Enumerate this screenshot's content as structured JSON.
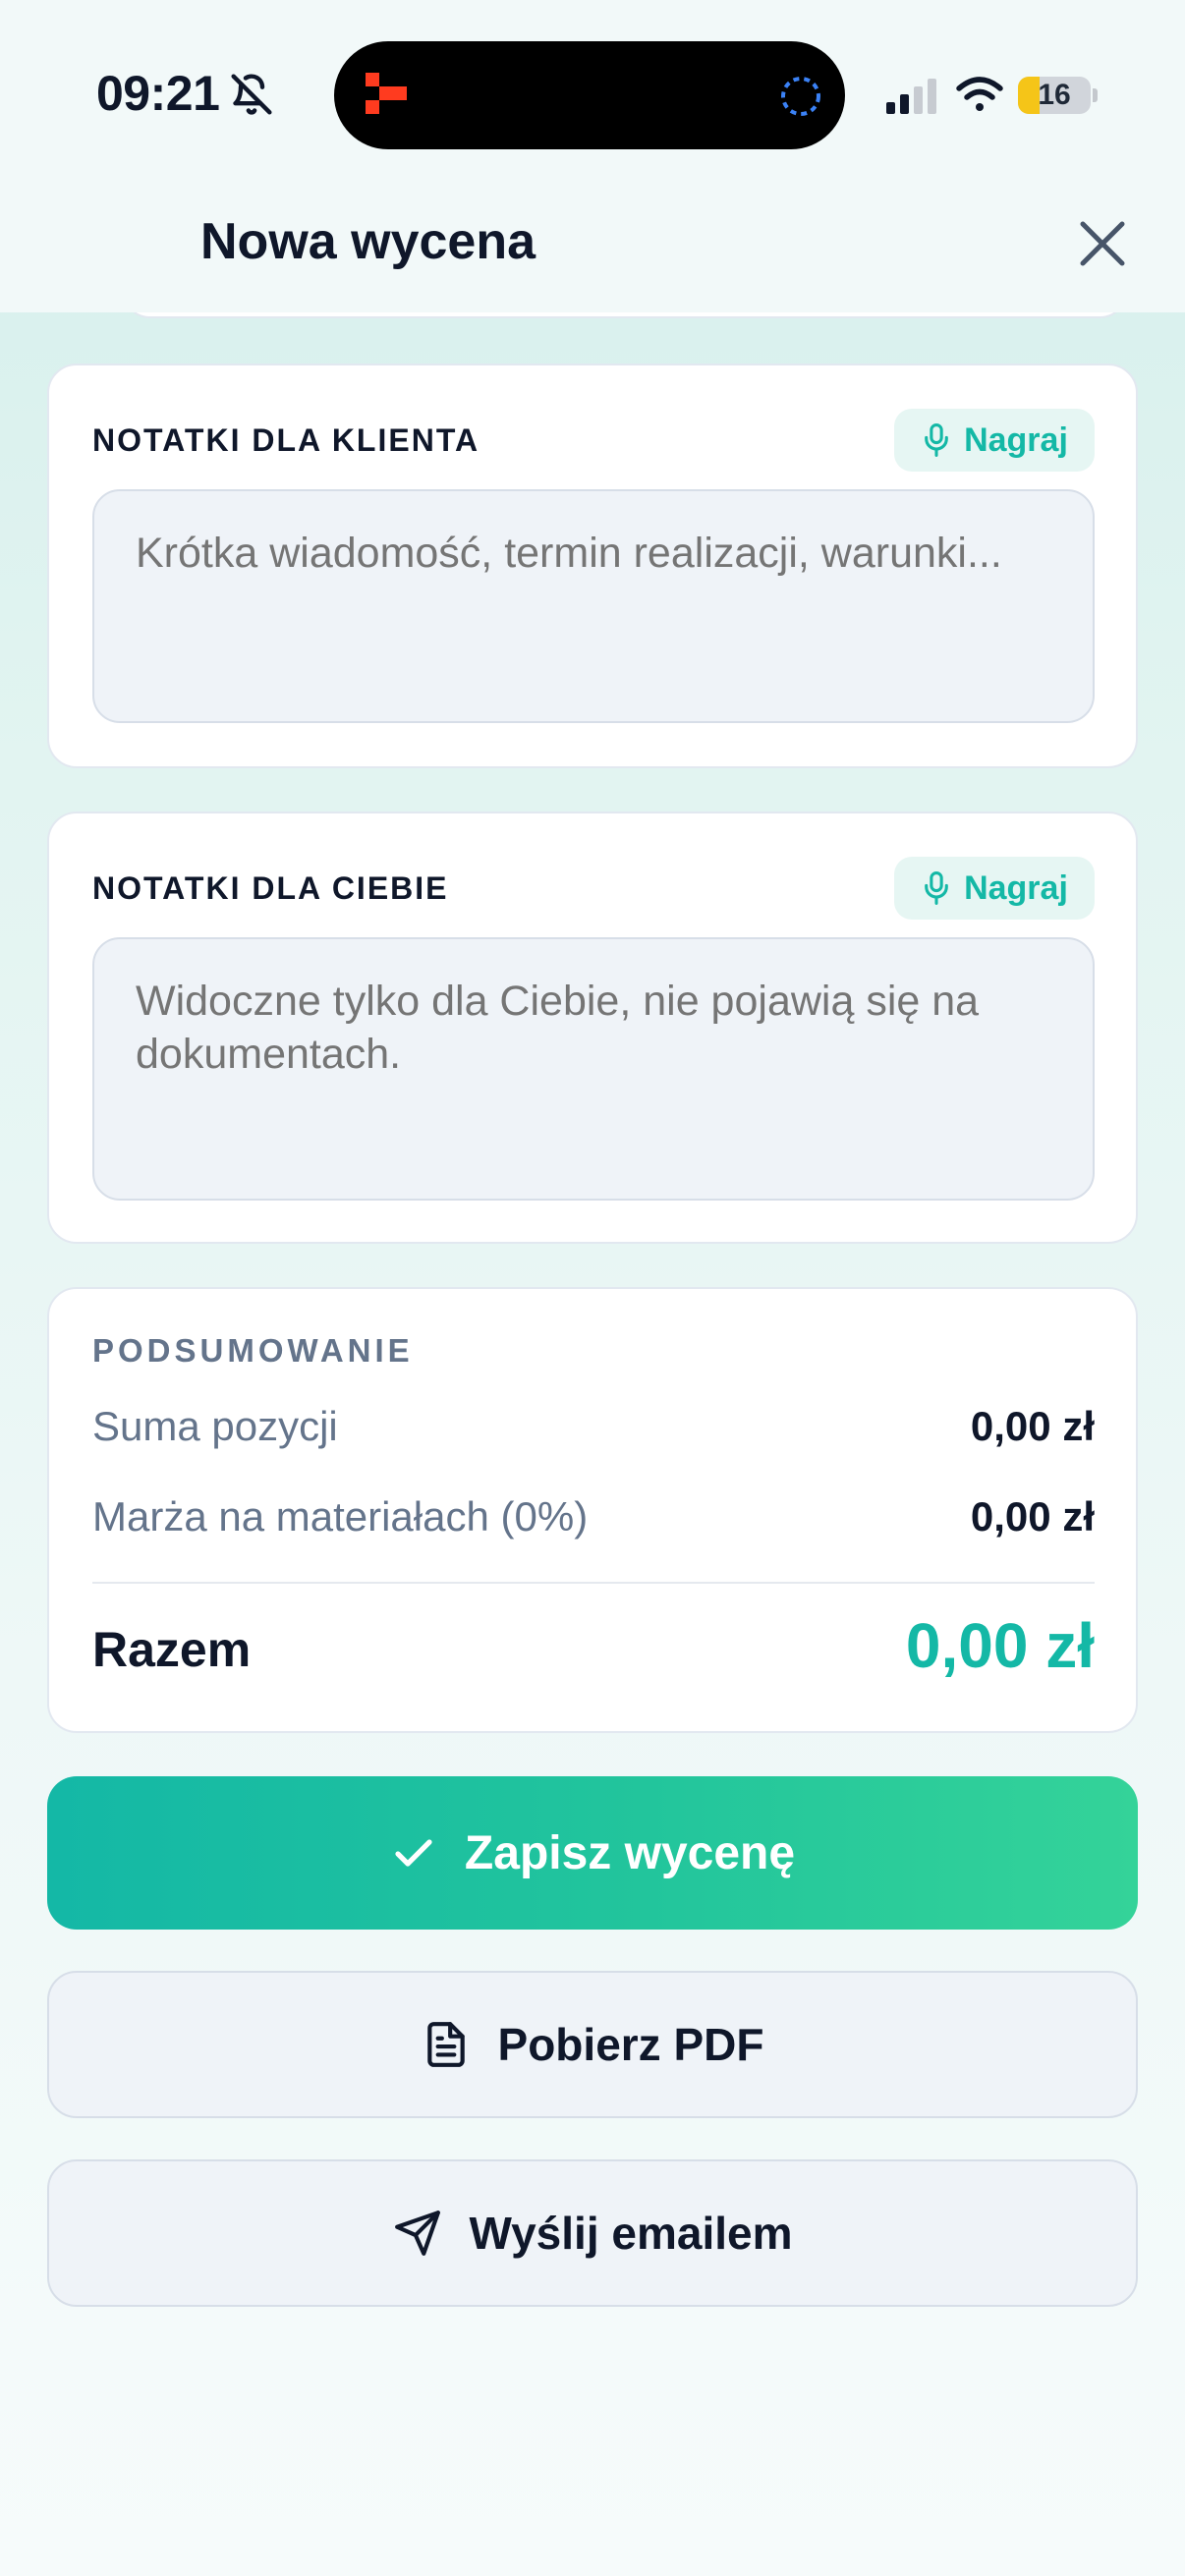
{
  "status_bar": {
    "time": "09:21",
    "battery_level": "16",
    "battery_fraction": 0.16,
    "icons": [
      "bell-slash-icon",
      "cellular-signal-icon",
      "wifi-icon",
      "battery-icon"
    ]
  },
  "header": {
    "title": "Nowa wycena",
    "close_icon": "close-icon"
  },
  "client_notes": {
    "label": "NOTATKI DLA KLIENTA",
    "record_label": "Nagraj",
    "placeholder": "Krótka wiadomość, termin realizacji, warunki...",
    "value": ""
  },
  "own_notes": {
    "label": "NOTATKI DLA CIEBIE",
    "record_label": "Nagraj",
    "placeholder": "Widoczne tylko dla Ciebie, nie pojawią się na dokumentach.",
    "value": ""
  },
  "summary": {
    "label": "PODSUMOWANIE",
    "rows": [
      {
        "label": "Suma pozycji",
        "value": "0,00 zł"
      },
      {
        "label": "Marża na materiałach (0%)",
        "value": "0,00 zł"
      }
    ],
    "total_label": "Razem",
    "total_value": "0,00 zł"
  },
  "actions": {
    "save": "Zapisz wycenę",
    "pdf": "Pobierz PDF",
    "email": "Wyślij emailem"
  },
  "colors": {
    "accent": "#14b8a6",
    "accent_end": "#34d399",
    "text": "#0f172a",
    "muted": "#64748b"
  }
}
